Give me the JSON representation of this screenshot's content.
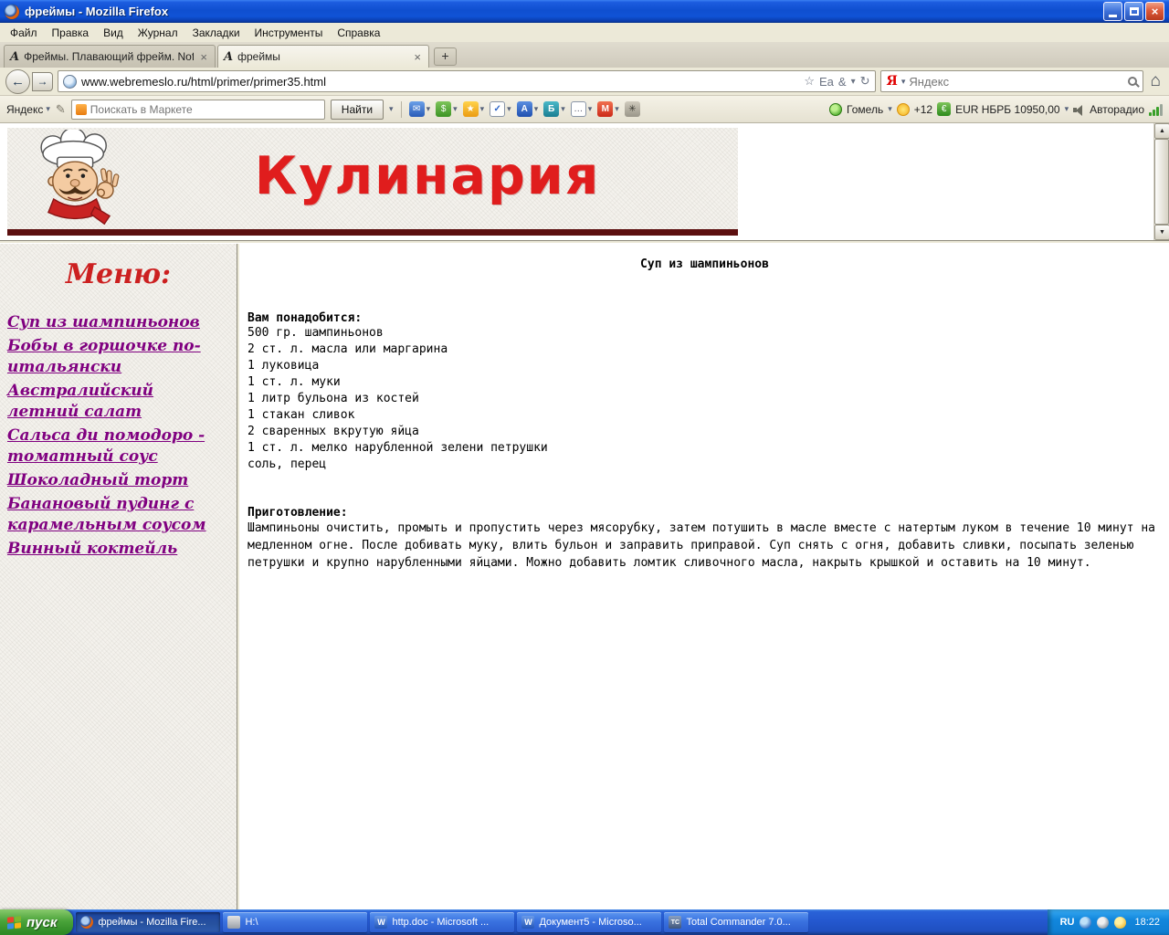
{
  "window": {
    "title": "фреймы - Mozilla Firefox"
  },
  "menubar": {
    "items": [
      "Файл",
      "Правка",
      "Вид",
      "Журнал",
      "Закладки",
      "Инструменты",
      "Справка"
    ]
  },
  "tabbar": {
    "tab1_label": "Фреймы. Плавающий фрейм. Noframes...",
    "tab2_label": "фреймы"
  },
  "navbar": {
    "url": "www.webremeslo.ru/html/primer/primer35.html",
    "search_placeholder": "Яндекс"
  },
  "yabar": {
    "brand": "Яндекс",
    "market_placeholder": "Поискать в Маркете",
    "find_label": "Найти",
    "city": "Гомель",
    "temperature": "+12",
    "currency": "EUR НБРБ 10950,00",
    "radio": "Авторадио"
  },
  "page": {
    "banner_title": "Кулинария",
    "menu_heading": "Меню:",
    "menu_links": [
      "Суп из шампиньонов",
      "Бобы в горшочке по-итальянски",
      "Австралийский летний салат",
      "Сальса ди помодоро - томатный соус",
      "Шоколадный торт",
      "Банановый пудинг с карамельным соусом",
      "Винный коктейль"
    ],
    "recipe_title": "Суп из шампиньонов",
    "ingredients_heading": "Вам понадобится:",
    "ingredients": [
      "500 гр. шампиньонов",
      "2 ст. л. масла или маргарина",
      "1 луковица",
      "1 ст. л. муки",
      "1 литр бульона из костей",
      "1 стакан сливок",
      "2 сваренных вкрутую яйца",
      "1 ст. л. мелко нарубленной зелени петрушки",
      "соль, перец"
    ],
    "preparation_heading": "Приготовление:",
    "preparation_text": "Шампиньоны очистить, промыть и пропустить через мясорубку, затем потушить в масле вместе с натертым луком в течение 10 минут на медленном огне. После добивать муку, влить бульон и заправить приправой. Суп снять с огня, добавить сливки, посыпать зеленью петрушки и крупно нарубленными яйцами. Можно добавить ломтик сливочного масла, накрыть крышкой и оставить на 10 минут."
  },
  "taskbar": {
    "start_label": "пуск",
    "tasks": [
      "фреймы - Mozilla Fire...",
      "H:\\",
      "http.doc - Microsoft ...",
      "Документ5 - Microso...",
      "Total Commander 7.0..."
    ],
    "language": "RU",
    "clock": "18:22"
  },
  "icons": {
    "favicon": "A",
    "back": "←",
    "forward": "→",
    "star": "☆",
    "translate_badge": "Ea",
    "ampersand": "&",
    "caret": "▾",
    "reload": "↻",
    "home": "⌂",
    "close": "×",
    "new_tab": "+",
    "scroll_up": "▲",
    "scroll_down": "▼",
    "mail": "✉",
    "money": "$",
    "star_solid": "★",
    "check": "✓",
    "letter_a": "А",
    "letter_b": "Б",
    "dots": "…",
    "letter_m": "М",
    "gear": "✳",
    "edit": "✎",
    "euro": "€",
    "ya": "Я",
    "word": "W",
    "tc": "TC"
  },
  "colors": {
    "banner_red": "#e01d1d",
    "link_purple": "#800080",
    "menu_heading_red": "#cc2020",
    "maroon_rule": "#5c0f0f"
  }
}
